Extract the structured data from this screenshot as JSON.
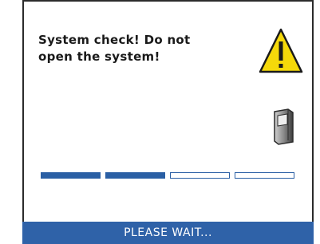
{
  "screen": {
    "message_lines": [
      "System check! Do not",
      "open the system!"
    ],
    "warning_icon": "warning-triangle-icon",
    "device_icon": "device-icon"
  },
  "progress": {
    "total_segments": 4,
    "filled_segments": 2,
    "fraction": 0.5
  },
  "status": {
    "text": "PLEASE WAIT..."
  },
  "colors": {
    "accent": "#2f62a8",
    "warning": "#f5d90a",
    "text": "#1a1a1a",
    "background": "#ffffff"
  }
}
